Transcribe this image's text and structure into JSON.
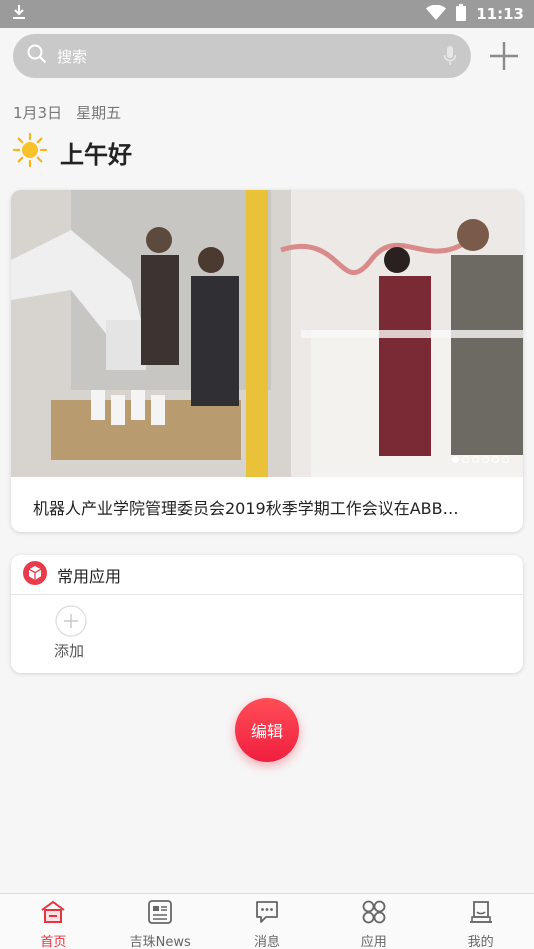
{
  "status_bar": {
    "time": "11:13"
  },
  "search": {
    "placeholder": "搜索"
  },
  "date": {
    "day": "1月3日",
    "weekday": "星期五"
  },
  "greeting": "上午好",
  "news": {
    "title": "机器人产业学院管理委员会2019秋季学期工作会议在ABB…",
    "carousel_total": 6,
    "carousel_active_index": 0
  },
  "apps": {
    "section_title": "常用应用",
    "add_label": "添加"
  },
  "edit_button": "编辑",
  "tabs": [
    {
      "label": "首页",
      "icon": "home-icon",
      "active": true
    },
    {
      "label": "吉珠News",
      "icon": "news-icon",
      "active": false
    },
    {
      "label": "消息",
      "icon": "message-icon",
      "active": false
    },
    {
      "label": "应用",
      "icon": "apps-icon",
      "active": false
    },
    {
      "label": "我的",
      "icon": "profile-icon",
      "active": false
    }
  ],
  "colors": {
    "accent": "#e8343f",
    "status_bar": "#9b9b9b",
    "search_bg": "#c9c9c9"
  }
}
